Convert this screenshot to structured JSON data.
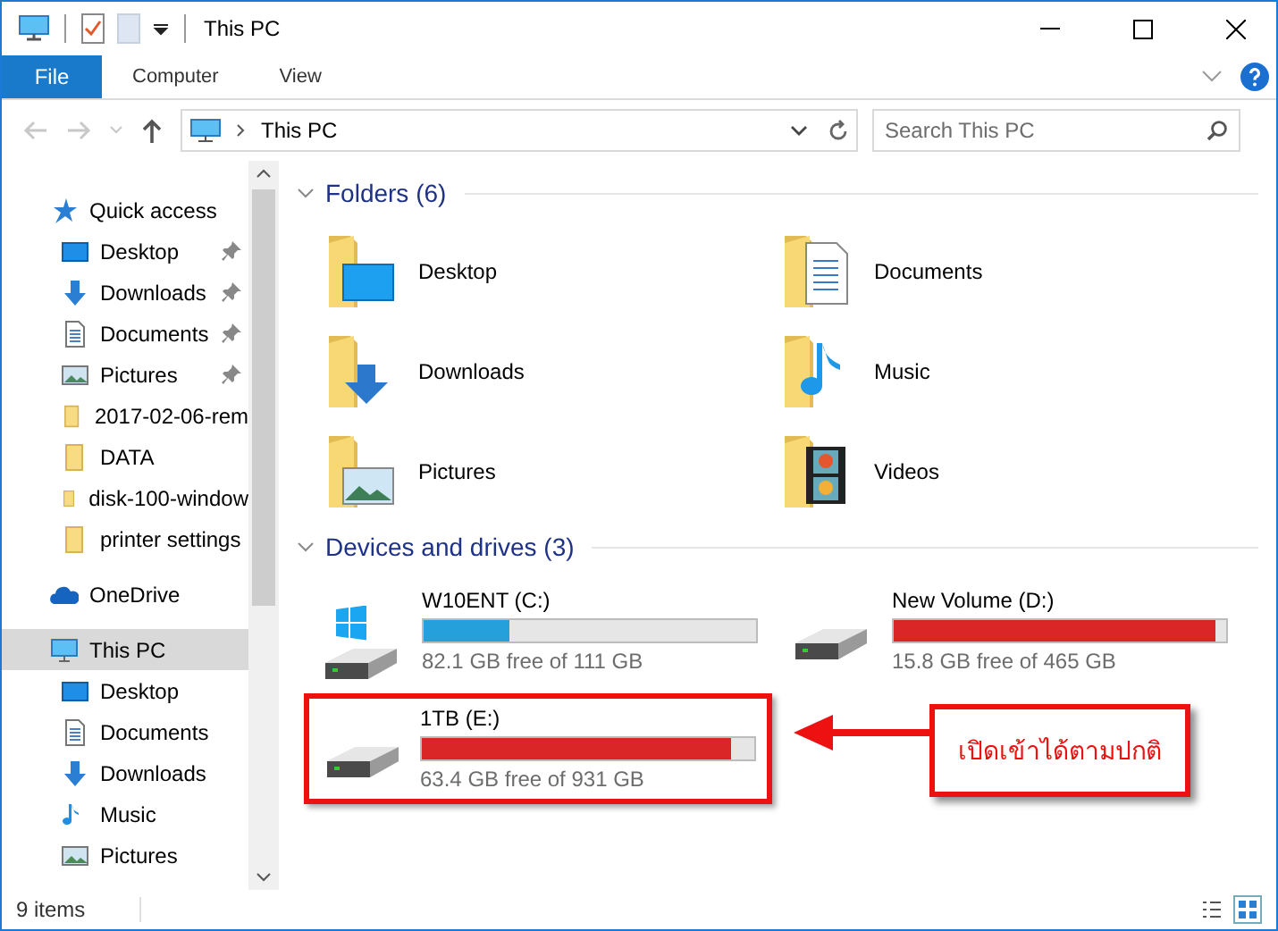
{
  "window": {
    "title": "This PC"
  },
  "ribbon": {
    "file_tab": "File",
    "tabs": [
      {
        "label": "Computer"
      },
      {
        "label": "View"
      }
    ]
  },
  "address_bar": {
    "path": "This PC",
    "search": {
      "placeholder": "Search This PC"
    }
  },
  "sidebar": {
    "items": [
      {
        "label": "Quick access",
        "kind": "star",
        "selected": false,
        "children": [
          {
            "label": "Desktop",
            "kind": "desktop",
            "selected": false,
            "pinned": true
          },
          {
            "label": "Downloads",
            "kind": "downloads",
            "selected": false,
            "pinned": true
          },
          {
            "label": "Documents",
            "kind": "documents",
            "selected": false,
            "pinned": true
          },
          {
            "label": "Pictures",
            "kind": "pictures",
            "selected": false,
            "pinned": true
          },
          {
            "label": "2017-02-06-rem",
            "kind": "folder",
            "selected": false,
            "pinned": false
          },
          {
            "label": "DATA",
            "kind": "folder",
            "selected": false,
            "pinned": false
          },
          {
            "label": "disk-100-window",
            "kind": "folder",
            "selected": false,
            "pinned": false
          },
          {
            "label": "printer settings",
            "kind": "folder",
            "selected": false,
            "pinned": false
          }
        ]
      },
      {
        "label": "OneDrive",
        "kind": "cloud",
        "selected": false
      },
      {
        "label": "This PC",
        "kind": "pc",
        "selected": true,
        "children": [
          {
            "label": "Desktop",
            "kind": "desktop",
            "selected": false,
            "pinned": false
          },
          {
            "label": "Documents",
            "kind": "documents",
            "selected": false,
            "pinned": false
          },
          {
            "label": "Downloads",
            "kind": "downloads",
            "selected": false,
            "pinned": false
          },
          {
            "label": "Music",
            "kind": "music",
            "selected": false,
            "pinned": false
          },
          {
            "label": "Pictures",
            "kind": "pictures",
            "selected": false,
            "pinned": false
          }
        ]
      }
    ]
  },
  "folders": {
    "heading": "Folders (6)",
    "items": [
      {
        "label": "Desktop",
        "kind": "desktop"
      },
      {
        "label": "Documents",
        "kind": "documents"
      },
      {
        "label": "Downloads",
        "kind": "downloads"
      },
      {
        "label": "Music",
        "kind": "music"
      },
      {
        "label": "Pictures",
        "kind": "pictures"
      },
      {
        "label": "Videos",
        "kind": "videos"
      }
    ]
  },
  "drives": {
    "heading": "Devices and drives (3)",
    "items": [
      {
        "name": "W10ENT (C:)",
        "kind": "system",
        "level": 0.26,
        "color": "#26a0da",
        "free": "82.1 GB free of 111 GB",
        "highlighted": false
      },
      {
        "name": "New Volume (D:)",
        "kind": "plain",
        "level": 0.966,
        "color": "#da2626",
        "free": "15.8 GB free of 465 GB",
        "highlighted": false
      },
      {
        "name": "1TB (E:)",
        "kind": "plain",
        "level": 0.932,
        "color": "#da2626",
        "free": "63.4 GB free of 931 GB",
        "highlighted": true
      }
    ]
  },
  "annotation": {
    "text": "เปิดเข้าได้ตามปกติ"
  },
  "status_bar": {
    "count": "9 items"
  }
}
